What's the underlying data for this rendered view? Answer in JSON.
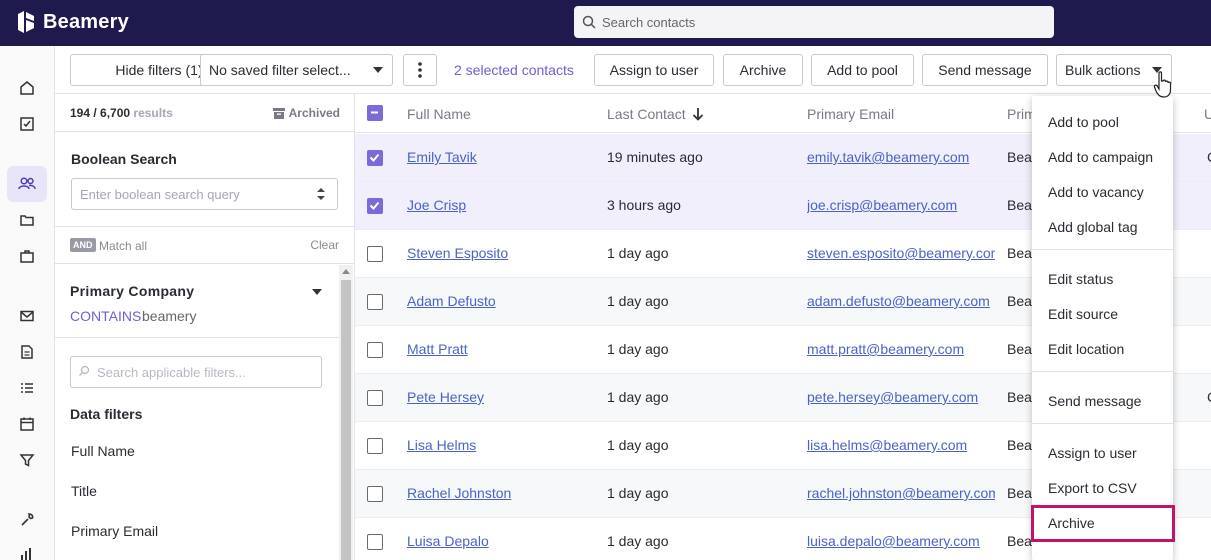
{
  "app": {
    "name": "Beamery"
  },
  "search": {
    "placeholder": "Search contacts"
  },
  "toolbar": {
    "hide_filters": "Hide filters (1)",
    "saved_filter": "No saved filter select...",
    "selected": "2 selected contacts",
    "assign": "Assign to user",
    "archive": "Archive",
    "add_pool": "Add to pool",
    "send_message": "Send message",
    "bulk_actions": "Bulk actions"
  },
  "filters": {
    "count": "194 / 6,700",
    "results_word": "results",
    "archived": "Archived",
    "boolean_title": "Boolean Search",
    "boolean_placeholder": "Enter boolean search query",
    "and_badge": "AND",
    "match_all": "Match all",
    "clear": "Clear",
    "company_title": "Primary Company",
    "company_op": "CONTAINS",
    "company_value": "beamery",
    "search_placeholder": "Search applicable filters...",
    "data_filters_title": "Data filters",
    "fields": [
      "Full Name",
      "Title",
      "Primary Email"
    ]
  },
  "table": {
    "headers": {
      "name": "Full Name",
      "last_contact": "Last Contact",
      "email": "Primary Email",
      "company": "Prim",
      "extra": "U"
    },
    "rows": [
      {
        "name": "Emily Tavik",
        "last": "19 minutes ago",
        "email": "emily.tavik@beamery.com",
        "company": "Bear",
        "extra": "C",
        "checked": true
      },
      {
        "name": "Joe Crisp",
        "last": "3 hours ago",
        "email": "joe.crisp@beamery.com",
        "company": "Bear",
        "extra": "",
        "checked": true
      },
      {
        "name": "Steven Esposito",
        "last": "1 day ago",
        "email": "steven.esposito@beamery.com",
        "company": "Bear",
        "extra": "",
        "checked": false
      },
      {
        "name": "Adam Defusto",
        "last": "1 day ago",
        "email": "adam.defusto@beamery.com",
        "company": "Bear",
        "extra": "",
        "checked": false
      },
      {
        "name": "Matt Pratt",
        "last": "1 day ago",
        "email": "matt.pratt@beamery.com",
        "company": "Bear",
        "extra": "",
        "checked": false
      },
      {
        "name": "Pete Hersey",
        "last": "1 day ago",
        "email": "pete.hersey@beamery.com",
        "company": "Bear",
        "extra": "C",
        "checked": false
      },
      {
        "name": "Lisa Helms",
        "last": "1 day ago",
        "email": "lisa.helms@beamery.com",
        "company": "Bear",
        "extra": "",
        "checked": false
      },
      {
        "name": "Rachel Johnston",
        "last": "1 day ago",
        "email": "rachel.johnston@beamery.com",
        "company": "Bear",
        "extra": "",
        "checked": false
      },
      {
        "name": "Luisa Depalo",
        "last": "1 day ago",
        "email": "luisa.depalo@beamery.com",
        "company": "Bea",
        "extra": "",
        "checked": false
      }
    ]
  },
  "bulk_menu": {
    "groups": [
      [
        "Add to pool",
        "Add to campaign",
        "Add to vacancy",
        "Add global tag"
      ],
      [
        "Edit status",
        "Edit source",
        "Edit location"
      ],
      [
        "Send message"
      ],
      [
        "Assign to user",
        "Export to CSV",
        "Archive"
      ]
    ],
    "highlighted": "Archive"
  },
  "colors": {
    "topbar": "#1f1a4d",
    "accent": "#6e5fd3",
    "link": "#4a63c9",
    "highlight": "#c0136b"
  }
}
